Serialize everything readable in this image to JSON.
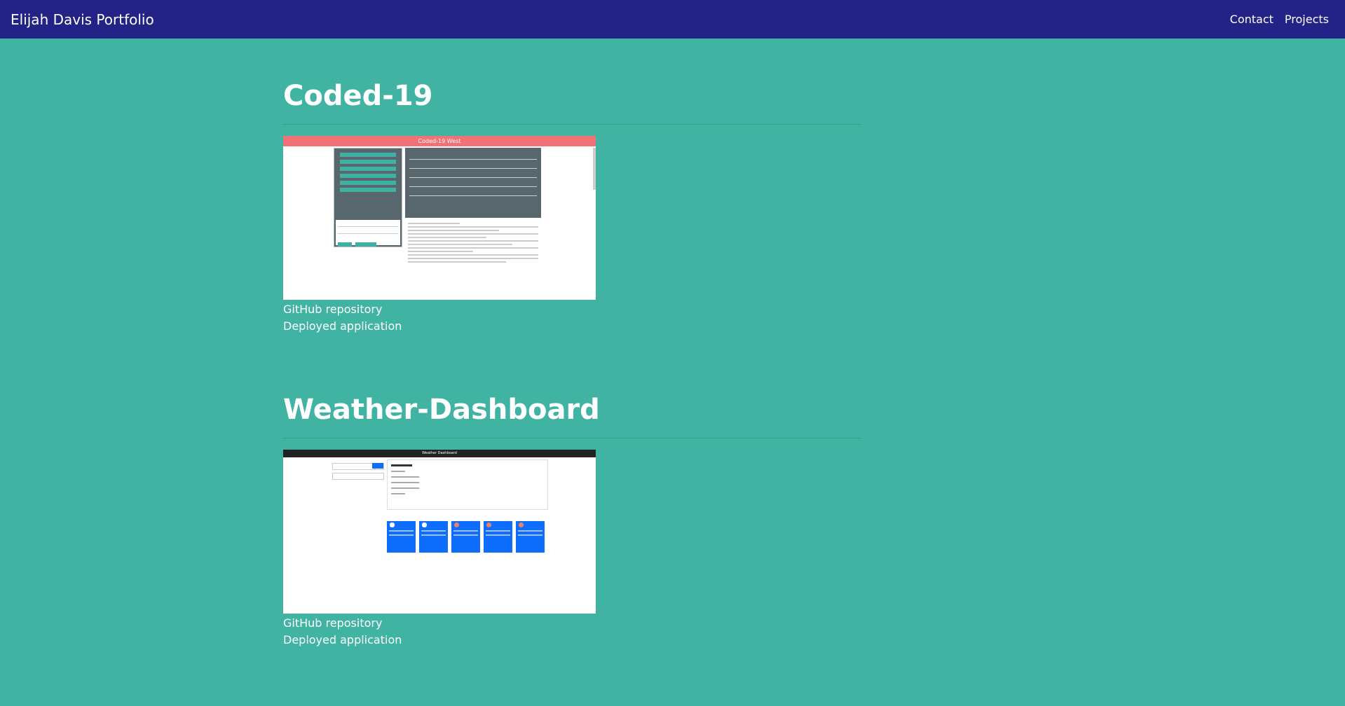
{
  "navbar": {
    "brand": "Elijah Davis Portfolio",
    "links": [
      "Contact",
      "Projects"
    ]
  },
  "projects": [
    {
      "title": "Coded-19",
      "screenshot_title": "Coded-19 West",
      "links": [
        "GitHub repository",
        "Deployed application"
      ]
    },
    {
      "title": "Weather-Dashboard",
      "screenshot_title": "Weather Dashboard",
      "links": [
        "GitHub repository",
        "Deployed application"
      ]
    }
  ]
}
